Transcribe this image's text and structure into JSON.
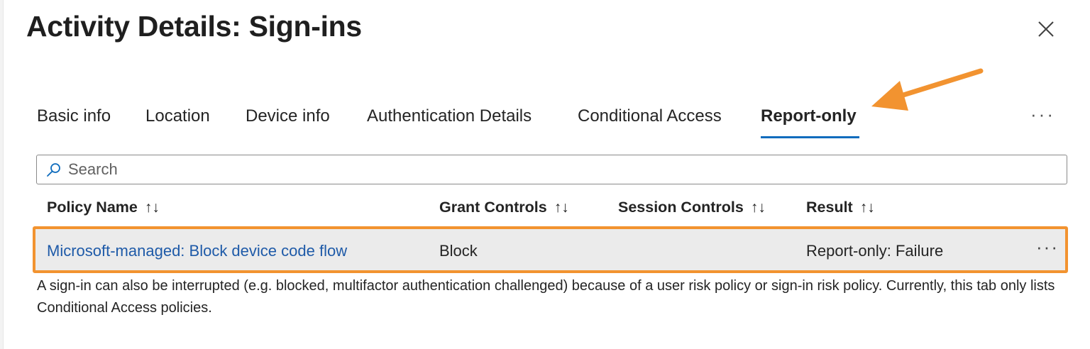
{
  "title": "Activity Details: Sign-ins",
  "icons": {
    "close": "close-icon",
    "search": "search-icon",
    "more": "more-horizontal-icon",
    "sort": "sort-up-down-icon"
  },
  "colors": {
    "accent": "#0f6cbd",
    "link": "#1e5aa8",
    "highlight_annotation": "#f29330",
    "row_background": "#ebebeb"
  },
  "tabs": [
    {
      "label": "Basic info",
      "active": false
    },
    {
      "label": "Location",
      "active": false
    },
    {
      "label": "Device info",
      "active": false
    },
    {
      "label": "Authentication Details",
      "active": false
    },
    {
      "label": "Conditional Access",
      "active": false
    },
    {
      "label": "Report-only",
      "active": true
    }
  ],
  "more_tabs_label": "···",
  "search": {
    "placeholder": "Search",
    "value": ""
  },
  "table": {
    "sort_glyph": "↑↓",
    "columns": [
      "Policy Name",
      "Grant Controls",
      "Session Controls",
      "Result"
    ],
    "rows": [
      {
        "policy_name": "Microsoft-managed: Block device code flow",
        "grant_controls": "Block",
        "session_controls": "",
        "result": "Report-only: Failure",
        "more": "···"
      }
    ]
  },
  "note": "A sign-in can also be interrupted (e.g. blocked, multifactor authentication challenged) because of a user risk policy or sign-in risk policy. Currently, this tab only lists Conditional Access policies."
}
